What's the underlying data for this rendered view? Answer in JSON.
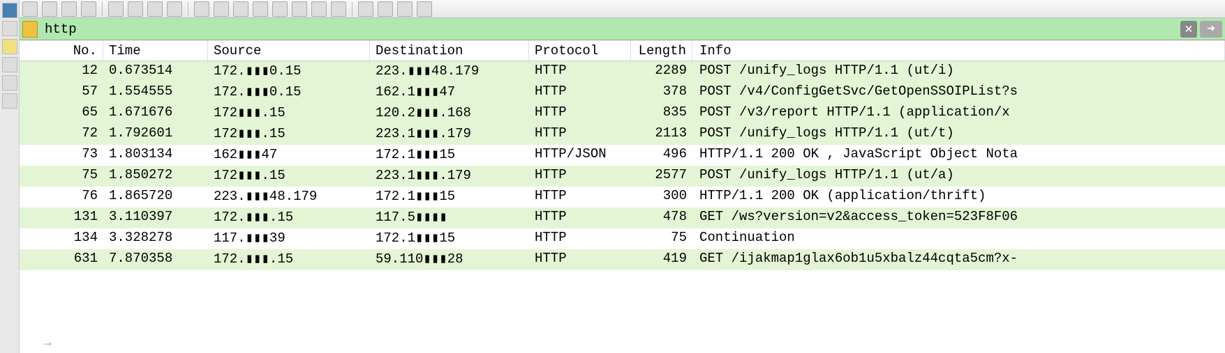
{
  "filter": {
    "value": "http"
  },
  "columns": {
    "no": "No.",
    "time": "Time",
    "source": "Source",
    "destination": "Destination",
    "protocol": "Protocol",
    "length": "Length",
    "info": "Info"
  },
  "rows": [
    {
      "no": "12",
      "time": "0.673514",
      "src": "172.▮▮▮0.15",
      "dst": "223.▮▮▮48.179",
      "proto": "HTTP",
      "len": "2289",
      "info": "POST /unify_logs HTTP/1.1  (ut/i)",
      "hl": true
    },
    {
      "no": "57",
      "time": "1.554555",
      "src": "172.▮▮▮0.15",
      "dst": "162.1▮▮▮47",
      "proto": "HTTP",
      "len": "378",
      "info": "POST /v4/ConfigGetSvc/GetOpenSSOIPList?s",
      "hl": true
    },
    {
      "no": "65",
      "time": "1.671676",
      "src": "172▮▮▮.15",
      "dst": "120.2▮▮▮.168",
      "proto": "HTTP",
      "len": "835",
      "info": "POST /v3/report HTTP/1.1  (application/x",
      "hl": true
    },
    {
      "no": "72",
      "time": "1.792601",
      "src": "172▮▮▮.15",
      "dst": "223.1▮▮▮.179",
      "proto": "HTTP",
      "len": "2113",
      "info": "POST /unify_logs HTTP/1.1  (ut/t)",
      "hl": true
    },
    {
      "no": "73",
      "time": "1.803134",
      "src": "162▮▮▮47",
      "dst": "172.1▮▮▮15",
      "proto": "HTTP/JSON",
      "len": "496",
      "info": "HTTP/1.1 200 OK , JavaScript Object Nota",
      "hl": false
    },
    {
      "no": "75",
      "time": "1.850272",
      "src": "172▮▮▮.15",
      "dst": "223.1▮▮▮.179",
      "proto": "HTTP",
      "len": "2577",
      "info": "POST /unify_logs HTTP/1.1  (ut/a)",
      "hl": true
    },
    {
      "no": "76",
      "time": "1.865720",
      "src": "223.▮▮▮48.179",
      "dst": "172.1▮▮▮15",
      "proto": "HTTP",
      "len": "300",
      "info": "HTTP/1.1 200 OK  (application/thrift)",
      "hl": false
    },
    {
      "no": "131",
      "time": "3.110397",
      "src": "172.▮▮▮.15",
      "dst": "117.5▮▮▮▮",
      "proto": "HTTP",
      "len": "478",
      "info": "GET /ws?version=v2&access_token=523F8F06",
      "hl": true
    },
    {
      "no": "134",
      "time": "3.328278",
      "src": "117.▮▮▮39",
      "dst": "172.1▮▮▮15",
      "proto": "HTTP",
      "len": "75",
      "info": "Continuation",
      "hl": false
    },
    {
      "no": "631",
      "time": "7.870358",
      "src": "172.▮▮▮.15",
      "dst": "59.110▮▮▮28",
      "proto": "HTTP",
      "len": "419",
      "info": "GET /ijakmap1glax6ob1u5xbalz44cqta5cm?x-",
      "hl": true
    }
  ]
}
